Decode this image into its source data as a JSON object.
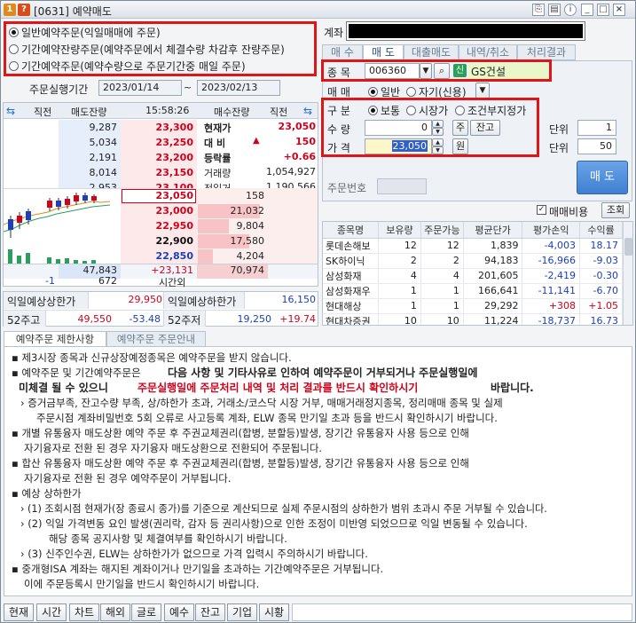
{
  "window": {
    "badge1": "1",
    "badge2": "?",
    "title": "[0631] 예약매도"
  },
  "order_type": {
    "options": [
      "일반예약주문(익일매매에 주문)",
      "기간예약잔량주문(예약주문에서 체결수량 차감후 잔량주문)",
      "기간예약주문(예약수량으로 주문기간중 매일 주문)"
    ],
    "selected": 0
  },
  "period": {
    "label": "주문실행기간",
    "start": "2023/01/14",
    "sep": "~",
    "end": "2023/02/13"
  },
  "account": {
    "label": "계좌",
    "value": ""
  },
  "main_tabs": [
    "매 수",
    "매 도",
    "대출매도",
    "내역/취소",
    "처리결과"
  ],
  "stock": {
    "label": "종 목",
    "code": "006360",
    "badge": "신",
    "name": "GS건설"
  },
  "trade": {
    "label": "매 매",
    "options": [
      "일반",
      "자기(신용)"
    ],
    "selected": 0
  },
  "gubun": {
    "label": "구 분",
    "options": [
      "보통",
      "시장가",
      "조건부지정가"
    ],
    "selected": 0
  },
  "qty": {
    "label": "수 량",
    "value": "0",
    "btn1": "주",
    "btn2": "잔고",
    "unit_label": "단위",
    "unit": "1"
  },
  "price": {
    "label": "가 격",
    "value": "23,050",
    "btn": "원",
    "unit_label": "단위",
    "unit": "50"
  },
  "order_no": {
    "label": "주문번호"
  },
  "sell_button": "매 도",
  "orderbook": {
    "headers": [
      "직전",
      "매도잔량",
      "15:58:26",
      "매수잔량",
      "직전"
    ],
    "ask": [
      {
        "qty": "9,287",
        "price": "23,300"
      },
      {
        "qty": "5,034",
        "price": "23,250"
      },
      {
        "qty": "2,191",
        "price": "23,200"
      },
      {
        "qty": "8,014",
        "price": "23,150"
      },
      {
        "qty": "2,953",
        "price": "23,100"
      }
    ],
    "info": [
      {
        "label": "현재가",
        "value": "23,050"
      },
      {
        "label": "대 비",
        "arrow": "▲",
        "value": "150"
      },
      {
        "label": "등락률",
        "value": "+0.66"
      },
      {
        "label": "거래량",
        "value": "1,054,927"
      },
      {
        "label": "전일거",
        "value": "1,190,566"
      }
    ],
    "bid": [
      {
        "price": "23,050",
        "qty": "158"
      },
      {
        "price": "23,000",
        "qty": "21,032"
      },
      {
        "price": "22,950",
        "qty": "9,804"
      },
      {
        "price": "22,900",
        "qty": "17,580"
      },
      {
        "price": "22,850",
        "qty": "4,204"
      }
    ],
    "sum_ask": "47,843",
    "sum_diff": "+23,131",
    "sum_bid": "70,974",
    "foot_left": "-1",
    "foot_ask": "672",
    "foot_label": "시간외"
  },
  "limits": {
    "upper_label": "익일예상상한가",
    "upper": "29,950",
    "lower_label": "익일예상하한가",
    "lower": "16,150",
    "high52_label": "52주고",
    "high52": "49,550",
    "high52_pct": "-53.48",
    "low52_label": "52주저",
    "low52": "19,250",
    "low52_pct": "+19.74"
  },
  "holdings": {
    "fee_label": "매매비용",
    "query_btn": "조회",
    "headers": [
      "종목명",
      "보유량",
      "주문가능",
      "평균단가",
      "평가손익",
      "수익률"
    ],
    "rows": [
      {
        "name": "롯데손해보",
        "qty": "12",
        "avail": "12",
        "avg": "1,839",
        "pl": "-4,003",
        "rate": "18.17"
      },
      {
        "name": "SK하이닉",
        "qty": "2",
        "avail": "2",
        "avg": "94,183",
        "pl": "-16,966",
        "rate": "-9.03"
      },
      {
        "name": "삼성화재",
        "qty": "4",
        "avail": "4",
        "avg": "201,605",
        "pl": "-2,419",
        "rate": "-0.30"
      },
      {
        "name": "삼성화재우",
        "qty": "1",
        "avail": "1",
        "avg": "166,641",
        "pl": "-11,141",
        "rate": "-6.70"
      },
      {
        "name": "현대해상",
        "qty": "1",
        "avail": "1",
        "avg": "29,292",
        "pl": "+308",
        "rate": "+1.05"
      },
      {
        "name": "현대차증권",
        "qty": "10",
        "avail": "10",
        "avg": "11,224",
        "pl": "-18,737",
        "rate": "16.73"
      }
    ]
  },
  "info_tabs": [
    "예약주문 제한사항",
    "예약주문 주문안내"
  ],
  "notice": {
    "l1": "▪ 제3시장 종목과 신규상장예정종목은 예약주문을 받지 않습니다.",
    "l2a": "▪ 예약주문 및 기간예약주문은",
    "l2b": "다음 사항 및 기타사유로 인하여 예약주문이 거부되거나 주문실행일에",
    "l3a": "미체결 될 수 있으니",
    "l3b": "주문실행일에 주문처리 내역 및 처리 결과를 반드시 확인하시기",
    "l3c": "바랍니다.",
    "l4": "› 증거금부족, 잔고수량 부족, 상/하한가 초과, 거래소/코스닥 시장 거부, 매매거래정지종목, 정리매매 종목 및 실제",
    "l5": "주문시점 계좌비밀번호 5회 오류로 사고등록 계좌, ELW 종목 만기일 초과 등을 반드시 확인하시기 바랍니다.",
    "l6": "▪ 개별 유통융자 매도상환 예약 주문 후 주권교체권리(합병, 분할등)발생, 장기간 유통융자 사용 등으로 인해",
    "l7": "자기융자로 전환 된 경우 자기융자 매도상환으로 전환되어 주문됩니다.",
    "l8": "▪ 합산 유통융자 매도상환 예약 주문 후 주권교체권리(합병, 분할등)발생, 장기간 유통융자 사용 등으로 인해",
    "l9": "자기융자로 전환 된 경우 예약주문이 거부됩니다.",
    "l10": "▪ 예상 상하한가",
    "l11": "› (1) 조회시점 현재가(장 종료시 종가)를 기준으로 계산되므로 실제 주문시점의 상하한가 범위 초과시 주문 거부될 수 있습니다.",
    "l12": "› (2) 익일 가격변동 요인 발생(권리락, 감자 등 권리사항)으로 인한 조정이 미반영 되었으므로 익일 변동될 수 있습니다.",
    "l13": "해당 종목 공지사항 및 체결여부를 확인하시기 바랍니다.",
    "l14": "› (3) 신주인수권, ELW는 상하한가가 없으므로 가격 입력시 주의하시기 바랍니다.",
    "l15": "▪ 중개형ISA 계좌는 해지된 계좌이거나 만기일을 초과하는 기간예약주문은 거부됩니다.",
    "l16": "이에 주문등록시 만기일을 반드시 확인하시기 바랍니다."
  },
  "bottom_buttons": [
    "현재",
    "시간",
    "차트",
    "해외",
    "글로",
    "예수",
    "잔고",
    "기업",
    "시황"
  ]
}
